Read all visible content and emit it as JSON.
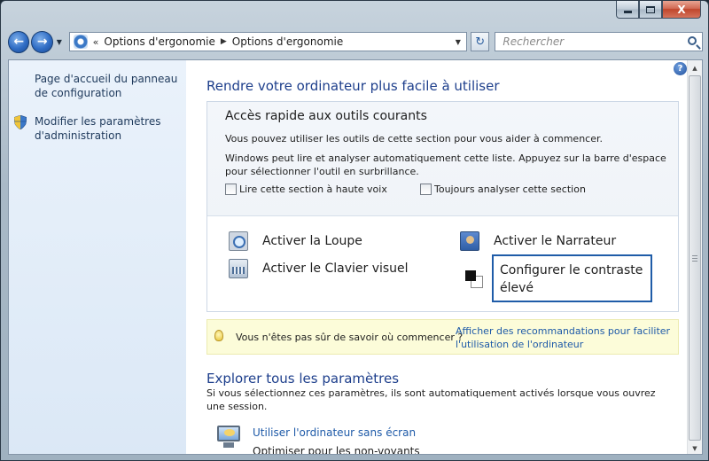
{
  "window": {
    "caption_close": "X"
  },
  "nav": {
    "back_glyph": "←",
    "forward_glyph": "→",
    "dropdown_glyph": "▼",
    "breadcrumb_chevron": "«",
    "breadcrumb": [
      "Options d'ergonomie",
      "Options d'ergonomie"
    ],
    "breadcrumb_sep": "▶",
    "refresh_glyph": "↻",
    "search_placeholder": "Rechercher"
  },
  "sidebar": {
    "items": [
      {
        "label": "Page d'accueil du panneau de configuration"
      },
      {
        "label": "Modifier les paramètres d'administration"
      }
    ]
  },
  "main": {
    "help_glyph": "?",
    "title": "Rendre votre ordinateur plus facile à utiliser",
    "quick": {
      "title": "Accès rapide aux outils courants",
      "text1": "Vous pouvez utiliser les outils de cette section pour vous aider à commencer.",
      "text2": "Windows peut lire et analyser automatiquement cette liste. Appuyez sur la barre d'espace pour sélectionner l'outil en surbrillance.",
      "checkbox1": "Lire cette section à haute voix",
      "checkbox2": "Toujours analyser cette section",
      "tools": {
        "loupe": "Activer la Loupe",
        "clavier": "Activer le Clavier visuel",
        "narrateur": "Activer le Narrateur",
        "contraste": "Configurer le contraste élevé"
      }
    },
    "tip": {
      "text": "Vous n'êtes pas sûr de savoir où commencer ?",
      "link": "Afficher des recommandations pour faciliter l'utilisation de l'ordinateur"
    },
    "explore": {
      "title": "Explorer tous les paramètres",
      "text": "Si vous sélectionnez ces paramètres, ils sont automatiquement activés lorsque vous ouvrez une session.",
      "setting_link": "Utiliser l'ordinateur sans écran",
      "setting_sub": "Optimiser pour les non-voyants"
    }
  },
  "scrollbar": {
    "up_glyph": "▲",
    "down_glyph": "▼"
  },
  "colors": {
    "link": "#1e5aa8",
    "heading": "#1e3f8c",
    "focus": "#1f5ca8",
    "tip_background": "#fcfcd9"
  }
}
